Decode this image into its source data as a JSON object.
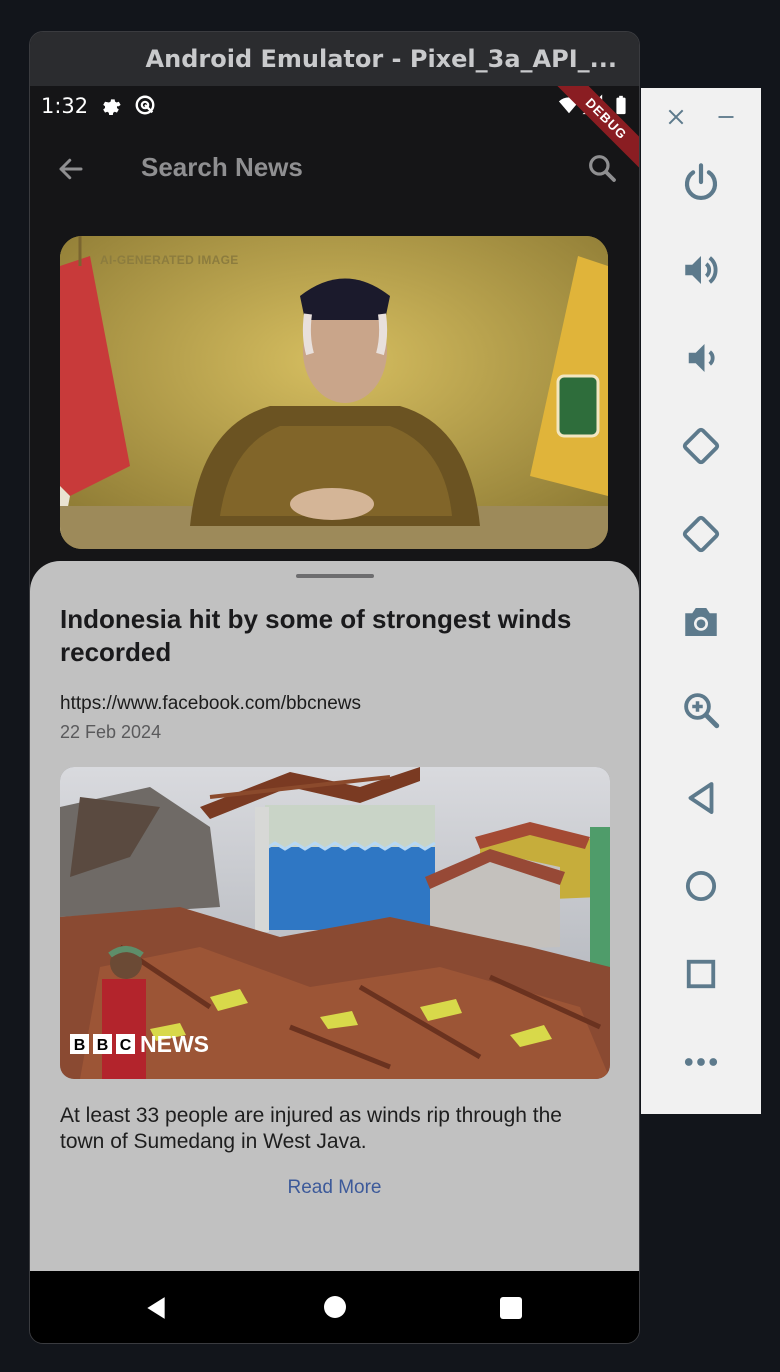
{
  "emulator": {
    "title": "Android Emulator - Pixel_3a_API_..."
  },
  "status_bar": {
    "time": "1:32",
    "debug_banner": "DEBUG"
  },
  "app_bar": {
    "title": "Search News",
    "back_icon": "arrow-left-icon",
    "search_icon": "search-icon"
  },
  "hero_card": {
    "tag": "AI-GENERATED IMAGE"
  },
  "article_sheet": {
    "headline": "Indonesia hit by some of strongest winds recorded",
    "source_url": "https://www.facebook.com/bbcnews",
    "date": "22 Feb 2024",
    "image_watermark": "NEWS",
    "image_watermark_letters": [
      "B",
      "B",
      "C"
    ],
    "summary": "At least 33 people are injured as winds rip through the town of Sumedang in West Java.",
    "read_more": "Read More"
  },
  "nav_bar": {
    "back": "triangle-back-icon",
    "home": "circle-home-icon",
    "recents": "square-recents-icon"
  },
  "toolbar": {
    "items": [
      "close-icon",
      "minimize-icon",
      "power-icon",
      "volume-up-icon",
      "volume-down-icon",
      "rotate-left-icon",
      "rotate-right-icon",
      "camera-icon",
      "zoom-icon",
      "back-icon",
      "home-icon",
      "overview-icon",
      "more-icon"
    ]
  },
  "colors": {
    "sheet_background": "#c1c1c1",
    "link": "#3d5a9a",
    "debug_banner": "#8a1d22",
    "toolbar_icon": "#5d7a8c"
  }
}
